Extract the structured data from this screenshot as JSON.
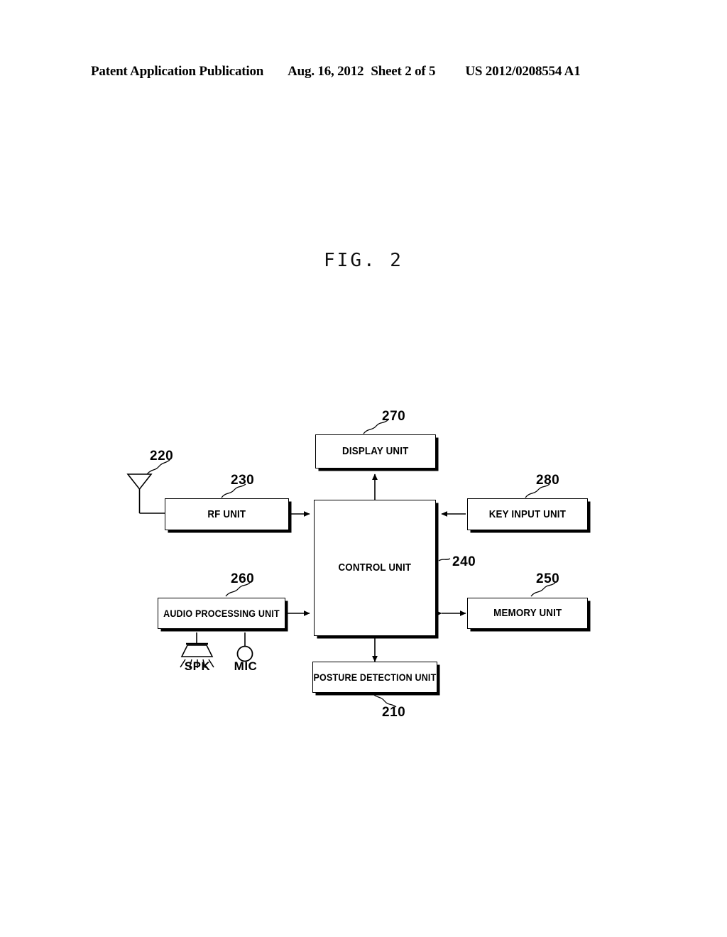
{
  "header": {
    "publication": "Patent Application Publication",
    "date": "Aug. 16, 2012",
    "sheet": "Sheet 2 of 5",
    "number": "US 2012/0208554 A1"
  },
  "figure": {
    "caption": "FIG. 2"
  },
  "diagram": {
    "type": "block-diagram",
    "blocks": [
      {
        "id": "display",
        "label": "DISPLAY UNIT",
        "ref": "270"
      },
      {
        "id": "rf",
        "label": "RF UNIT",
        "ref": "230"
      },
      {
        "id": "control",
        "label": "CONTROL UNIT",
        "ref": "240"
      },
      {
        "id": "keyinput",
        "label": "KEY INPUT UNIT",
        "ref": "280"
      },
      {
        "id": "audio",
        "label": "AUDIO PROCESSING UNIT",
        "ref": "260"
      },
      {
        "id": "memory",
        "label": "MEMORY UNIT",
        "ref": "250"
      },
      {
        "id": "posture",
        "label": "POSTURE DETECTION UNIT",
        "ref": "210"
      }
    ],
    "components": [
      {
        "id": "antenna",
        "label": "",
        "ref": "220",
        "icon": "antenna-icon"
      },
      {
        "id": "speaker",
        "label": "SPK",
        "ref": "",
        "icon": "speaker-icon"
      },
      {
        "id": "microphone",
        "label": "MIC",
        "ref": "",
        "icon": "microphone-icon"
      }
    ],
    "connections": [
      {
        "from": "control",
        "to": "display",
        "arrow": "single-up"
      },
      {
        "from": "rf",
        "to": "control",
        "arrow": "double"
      },
      {
        "from": "keyinput",
        "to": "control",
        "arrow": "single-left"
      },
      {
        "from": "audio",
        "to": "control",
        "arrow": "double"
      },
      {
        "from": "memory",
        "to": "control",
        "arrow": "double"
      },
      {
        "from": "posture",
        "to": "control",
        "arrow": "double-vertical"
      },
      {
        "from": "antenna",
        "to": "rf",
        "arrow": "line"
      },
      {
        "from": "audio",
        "to": "speaker",
        "arrow": "line"
      },
      {
        "from": "audio",
        "to": "microphone",
        "arrow": "line"
      }
    ],
    "refs": {
      "antenna": "220",
      "rf": "230",
      "control": "240",
      "memory": "250",
      "audio": "260",
      "display": "270",
      "keyinput": "280",
      "posture": "210"
    },
    "labels": {
      "display": "DISPLAY UNIT",
      "rf": "RF UNIT",
      "control": "CONTROL UNIT",
      "keyinput": "KEY INPUT UNIT",
      "audio": "AUDIO PROCESSING UNIT",
      "memory": "MEMORY UNIT",
      "posture": "POSTURE DETECTION UNIT",
      "spk": "SPK",
      "mic": "MIC"
    }
  }
}
